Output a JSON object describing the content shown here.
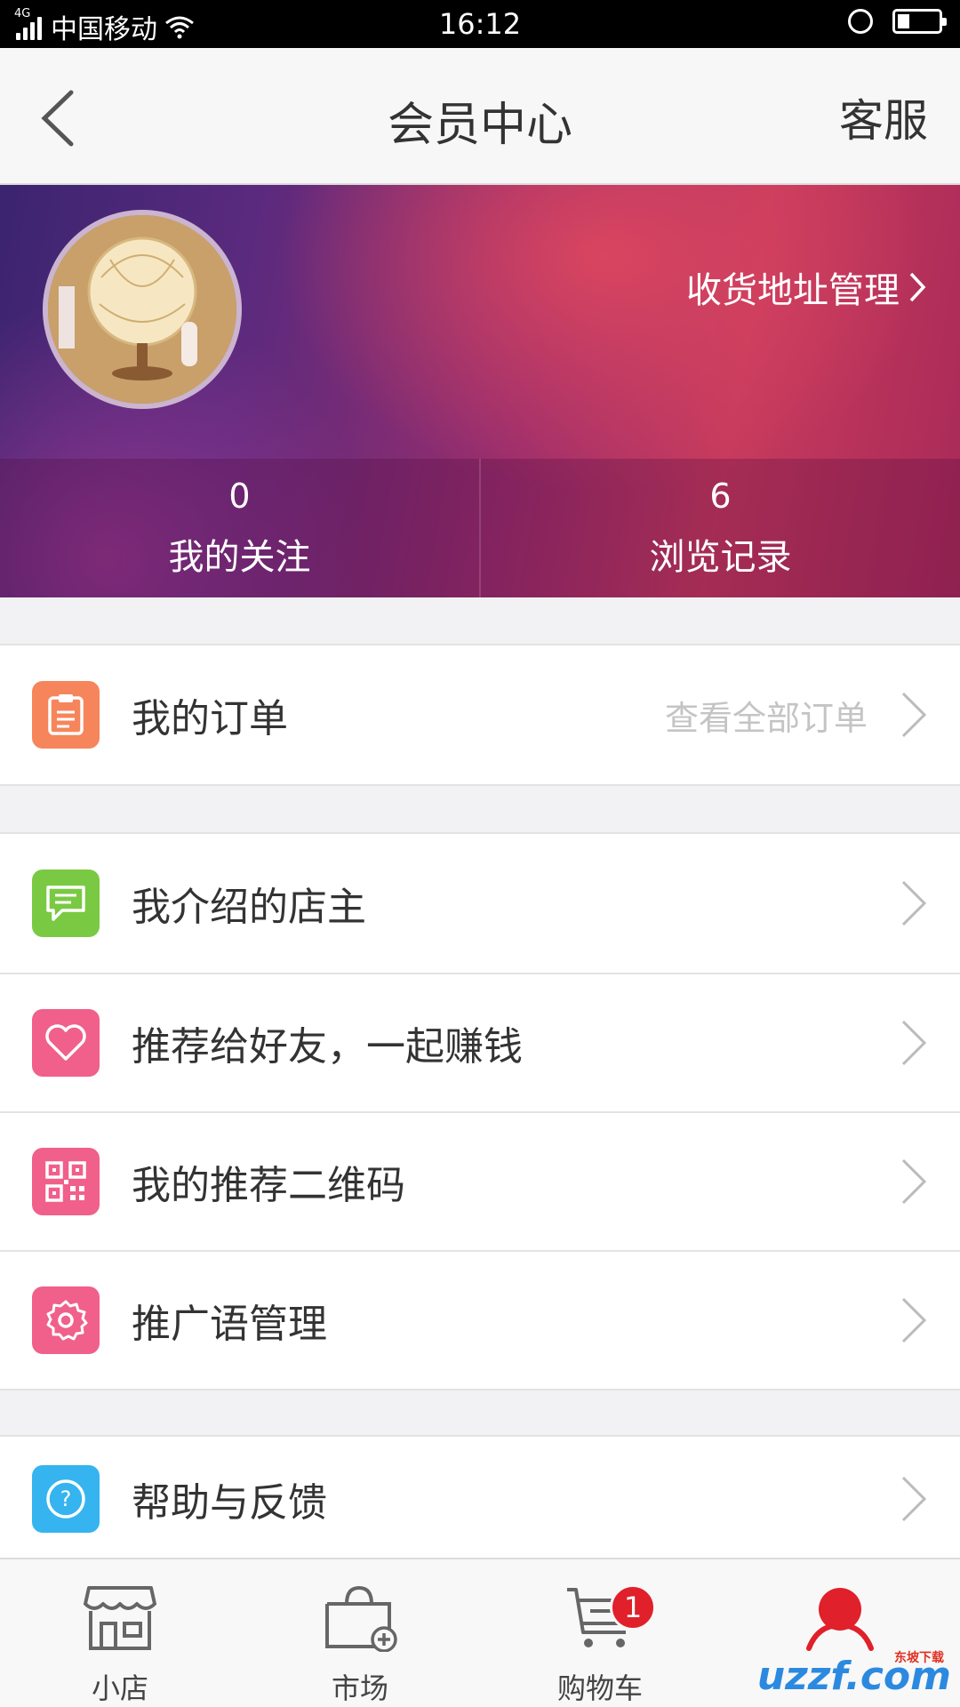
{
  "status_bar": {
    "network": "4G",
    "carrier": "中国移动",
    "time": "16:12",
    "battery_level": 0.3
  },
  "nav": {
    "title": "会员中心",
    "right_action": "客服"
  },
  "profile": {
    "address_link": "收货地址管理",
    "stats": [
      {
        "value": "0",
        "label": "我的关注"
      },
      {
        "value": "6",
        "label": "浏览记录"
      }
    ]
  },
  "orders": {
    "label": "我的订单",
    "hint": "查看全部订单",
    "icon": "clipboard-icon",
    "icon_color": "#f6855c"
  },
  "menu": [
    {
      "label": "我介绍的店主",
      "icon": "message-icon",
      "color": "#7ac943"
    },
    {
      "label": "推荐给好友，一起赚钱",
      "icon": "heart-icon",
      "color": "#f0608a"
    },
    {
      "label": "我的推荐二维码",
      "icon": "qrcode-icon",
      "color": "#f0608a"
    },
    {
      "label": "推广语管理",
      "icon": "gear-icon",
      "color": "#f0608a"
    }
  ],
  "help": {
    "label": "帮助与反馈",
    "icon": "question-icon",
    "color": "#35b4ef"
  },
  "tabbar": {
    "tabs": [
      {
        "label": "小店",
        "icon": "shop-icon"
      },
      {
        "label": "市场",
        "icon": "market-bag-icon"
      },
      {
        "label": "购物车",
        "icon": "cart-icon",
        "badge": "1"
      },
      {
        "label": "",
        "icon": "user-icon",
        "active_color": "#e0202a"
      }
    ]
  },
  "watermark": {
    "text": "uzzf.com",
    "sub": "东坡下载"
  }
}
